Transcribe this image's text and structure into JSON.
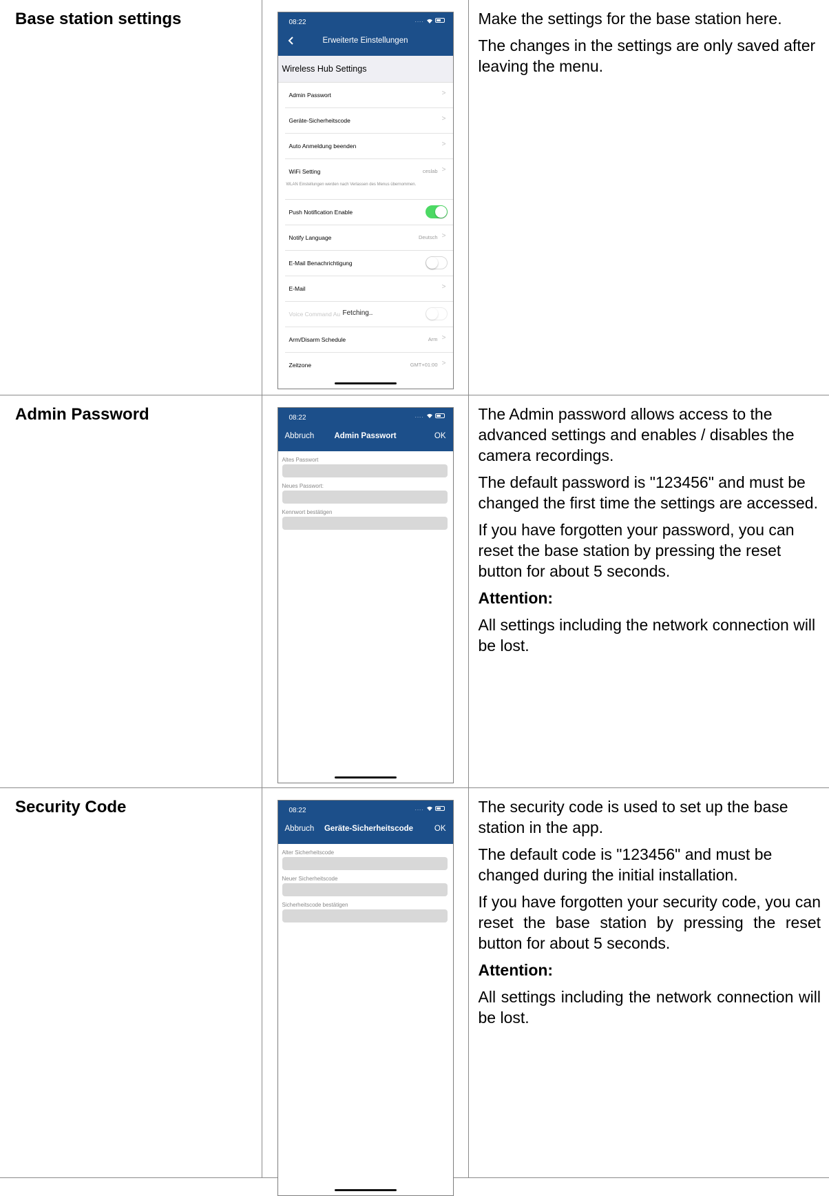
{
  "rows": [
    {
      "label": "Base station settings",
      "paragraphs": [
        "Make the settings for the base station here.",
        "The changes in the settings are only saved after leaving the menu."
      ],
      "phone": {
        "time": "08:22",
        "title": "Erweiterte Einstellungen",
        "section": "Wireless Hub Settings",
        "items": [
          {
            "label": "Admin Passwort",
            "value": ""
          },
          {
            "label": "Geräte-Sicherheitscode",
            "value": ""
          },
          {
            "label": "Auto Anmeldung beenden",
            "value": ""
          },
          {
            "label": "WiFi Setting",
            "value": "ceslab",
            "note": "WLAN Einstellungen werden nach Verlassen des Menus übernommen."
          },
          {
            "label": "Push Notification Enable",
            "toggle": "on"
          },
          {
            "label": "Notify Language",
            "value": "Deutsch"
          },
          {
            "label": "E-Mail Benachrichtigung",
            "toggle": "off"
          },
          {
            "label": "E-Mail",
            "value": ""
          },
          {
            "label": "Voice Command Au",
            "overlay": "Fetching..",
            "toggle": "off"
          },
          {
            "label": "Arm/Disarm Schedule",
            "value": "Arm"
          },
          {
            "label": "Zeitzone",
            "value": "GMT+01:00"
          }
        ]
      }
    },
    {
      "label": "Admin Password",
      "paragraphs": [
        "The Admin password allows access to the advanced settings and enables / disables the camera recordings.",
        "The default password is \"123456\" and must be changed the first time the settings are accessed.",
        "If you have forgotten your password, you can reset the base station by pressing the reset button for about 5 seconds."
      ],
      "attention": "Attention:",
      "after": "All settings including the network connection will be lost.",
      "phone": {
        "time": "08:22",
        "left": "Abbruch",
        "title": "Admin Passwort",
        "right": "OK",
        "fields": [
          "Altes Passwort",
          "Neues Passwort:",
          "Kennwort bestätigen"
        ]
      }
    },
    {
      "label": "Security Code",
      "paragraphs": [
        "The security code is used to set up the base station in the app.",
        "The default code is \"123456\" and must be changed during the initial installation.",
        "If you have forgotten your security code, you can reset the base station by pressing the reset button for about 5 seconds."
      ],
      "attention": "Attention:",
      "after": "All settings including the network connection will be lost.",
      "phone": {
        "time": "08:22",
        "left": "Abbruch",
        "title": "Geräte-Sicherheitscode",
        "right": "OK",
        "fields": [
          "Alter Sicherheitscode",
          "Neuer Sicherheitscode",
          "Sicherheitscode bestätigen"
        ]
      }
    }
  ]
}
